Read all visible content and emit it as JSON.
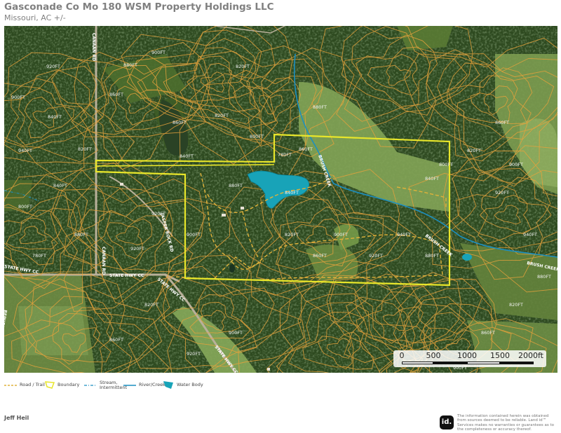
{
  "header": {
    "title": "Gasconade Co Mo 180 WSM Property Holdings LLC",
    "subtitle": "Missouri,  AC +/-"
  },
  "map": {
    "road_labels": [
      "CANAAN RD",
      "CANAAN RD",
      "STATE HWY CC",
      "STATE HWY CC",
      "STATE HWY CC",
      "STATE HWY CC",
      "JASPER ROCK RD",
      "REPUBLICAN RD",
      "BRUSH CREEK",
      "BRUSH CREEK",
      "BRUSH CREEK"
    ],
    "contour_labels": [
      "900FT",
      "840FT",
      "820FT",
      "860FT",
      "880FT",
      "920FT",
      "940FT",
      "900FT",
      "860FT",
      "840FT",
      "820FT",
      "800FT",
      "780FT",
      "880FT",
      "860FT",
      "820FT",
      "920FT",
      "900FT",
      "880FT",
      "840FT",
      "820FT",
      "860FT",
      "900FT",
      "920FT",
      "940FT",
      "880FT",
      "840FT",
      "800FT",
      "820FT",
      "860FT",
      "900FT",
      "920FT",
      "940FT",
      "880FT",
      "820FT",
      "860FT",
      "900FT",
      "780FT",
      "800FT",
      "840FT",
      "880FT",
      "920FT",
      "820FT",
      "860FT",
      "920FT",
      "900FT"
    ],
    "colors": {
      "boundary": "#e8e62a",
      "contour": "#e6a23c",
      "road_trail": "#e0b23a",
      "water_body": "#18a3b8",
      "river_creek": "#1c8fc0"
    }
  },
  "scale_bar": {
    "ticks": [
      "0",
      "500",
      "1000",
      "1500",
      "2000ft"
    ]
  },
  "legend": {
    "items": [
      {
        "label": "Road / Trail",
        "icon": "dashed-line"
      },
      {
        "label": "Boundary",
        "icon": "boundary-polygon"
      },
      {
        "label": "Stream,\nIntermittent",
        "icon": "dash-dot-line"
      },
      {
        "label": "River/Creek",
        "icon": "solid-line"
      },
      {
        "label": "Water Body",
        "icon": "water-polygon"
      }
    ]
  },
  "footer": {
    "agent": "Jeff Heil",
    "logo_text": "id.",
    "disclaimer": "The information contained herein was obtained from sources deemed to be reliable. Land id™ Services makes no warranties or guarantees as to the completeness or accuracy thereof."
  }
}
